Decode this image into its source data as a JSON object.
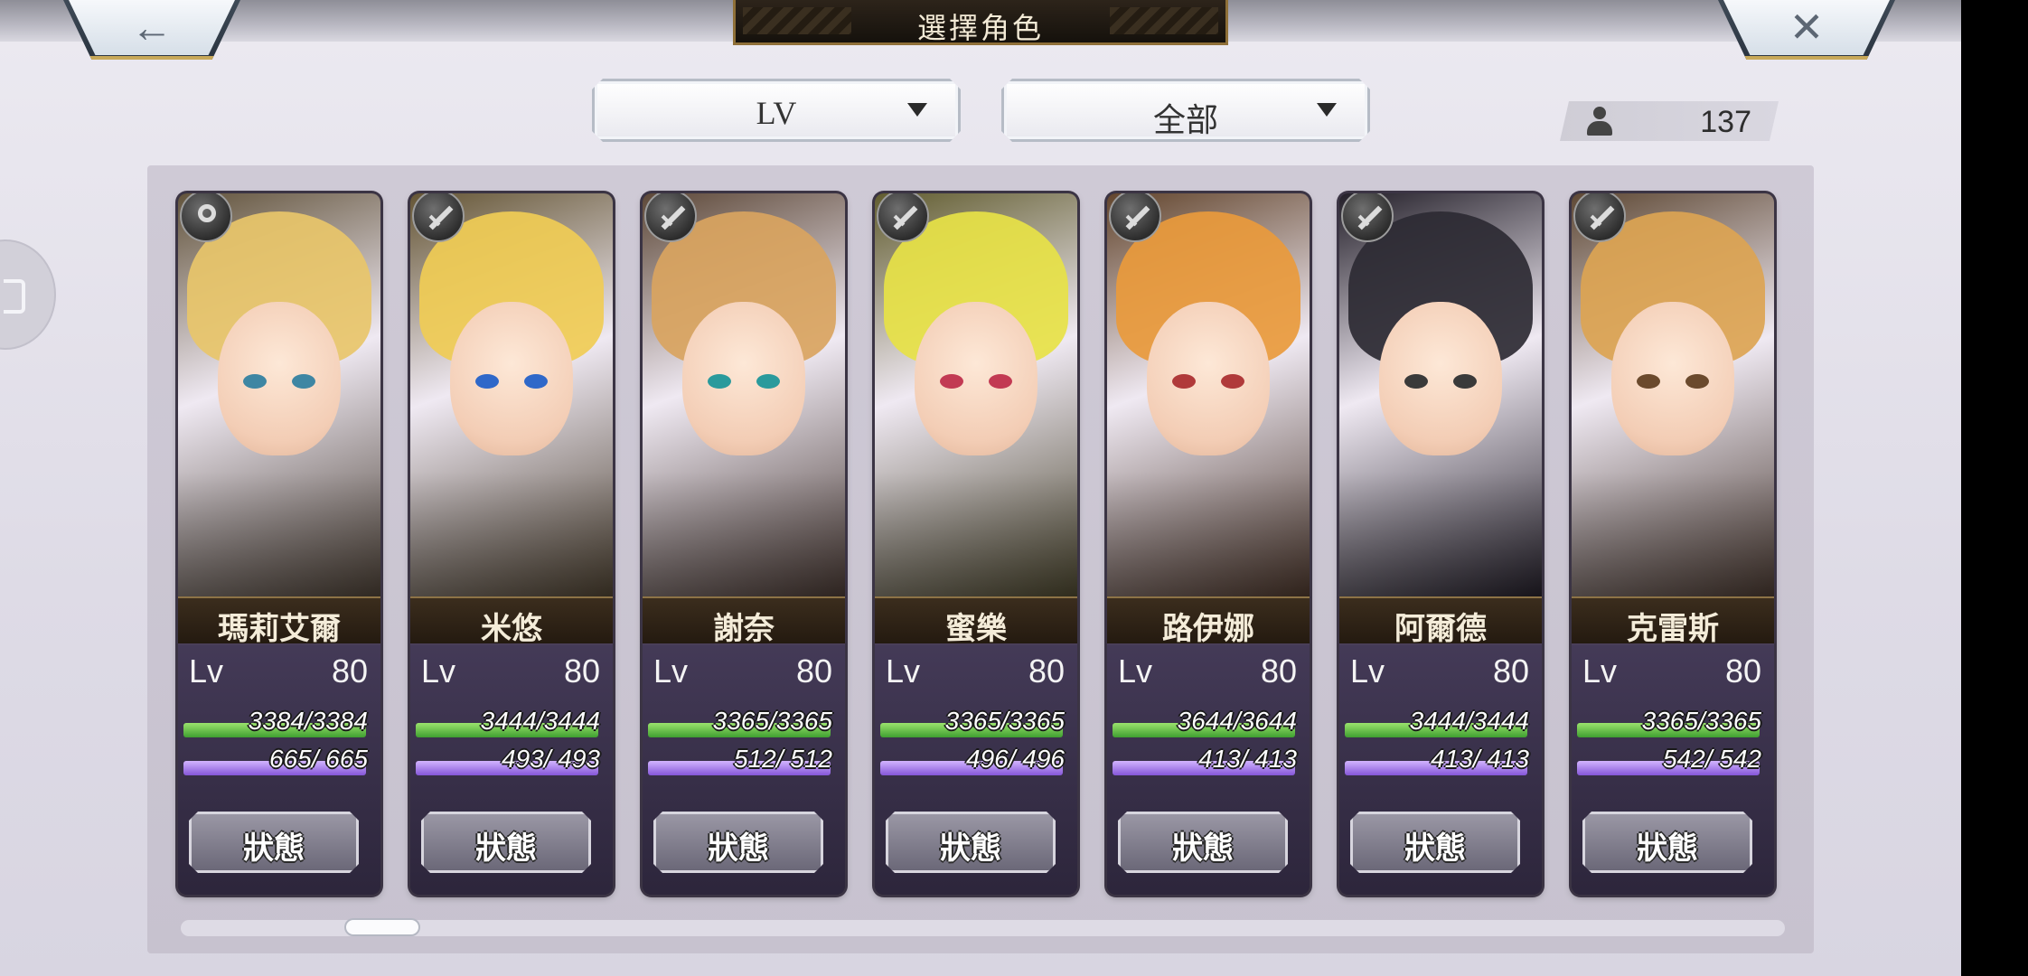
{
  "header": {
    "title": "選擇角色",
    "back_icon": "←",
    "close_icon": "✕"
  },
  "filters": {
    "sort": {
      "value": "LV"
    },
    "category": {
      "value": "全部"
    }
  },
  "character_count": "137",
  "status_label": "狀態",
  "lv_label": "Lv",
  "characters": [
    {
      "name": "瑪莉艾爾",
      "level": "80",
      "hp": "3384/3384",
      "mp": "665/ 665",
      "weapon_icon": "staff-icon",
      "hair_color": "#e8c66a",
      "eye_color": "#3e86a3"
    },
    {
      "name": "米悠",
      "level": "80",
      "hp": "3444/3444",
      "mp": "493/ 493",
      "weapon_icon": "sword-icon",
      "hair_color": "#f0cc55",
      "eye_color": "#2f68c9"
    },
    {
      "name": "謝奈",
      "level": "80",
      "hp": "3365/3365",
      "mp": "512/ 512",
      "weapon_icon": "sword-icon",
      "hair_color": "#d9a45f",
      "eye_color": "#2a9a9c"
    },
    {
      "name": "蜜樂",
      "level": "80",
      "hp": "3365/3365",
      "mp": "496/ 496",
      "weapon_icon": "sword-icon",
      "hair_color": "#e7e246",
      "eye_color": "#c23a53"
    },
    {
      "name": "路伊娜",
      "level": "80",
      "hp": "3644/3644",
      "mp": "413/ 413",
      "weapon_icon": "sword-icon",
      "hair_color": "#e99a3c",
      "eye_color": "#b03a3a"
    },
    {
      "name": "阿爾德",
      "level": "80",
      "hp": "3444/3444",
      "mp": "413/ 413",
      "weapon_icon": "sword-icon",
      "hair_color": "#2c2a33",
      "eye_color": "#3a3a3a"
    },
    {
      "name": "克雷斯",
      "level": "80",
      "hp": "3365/3365",
      "mp": "542/ 542",
      "weapon_icon": "sword-icon",
      "hair_color": "#dca453",
      "eye_color": "#6b4a2d"
    }
  ]
}
